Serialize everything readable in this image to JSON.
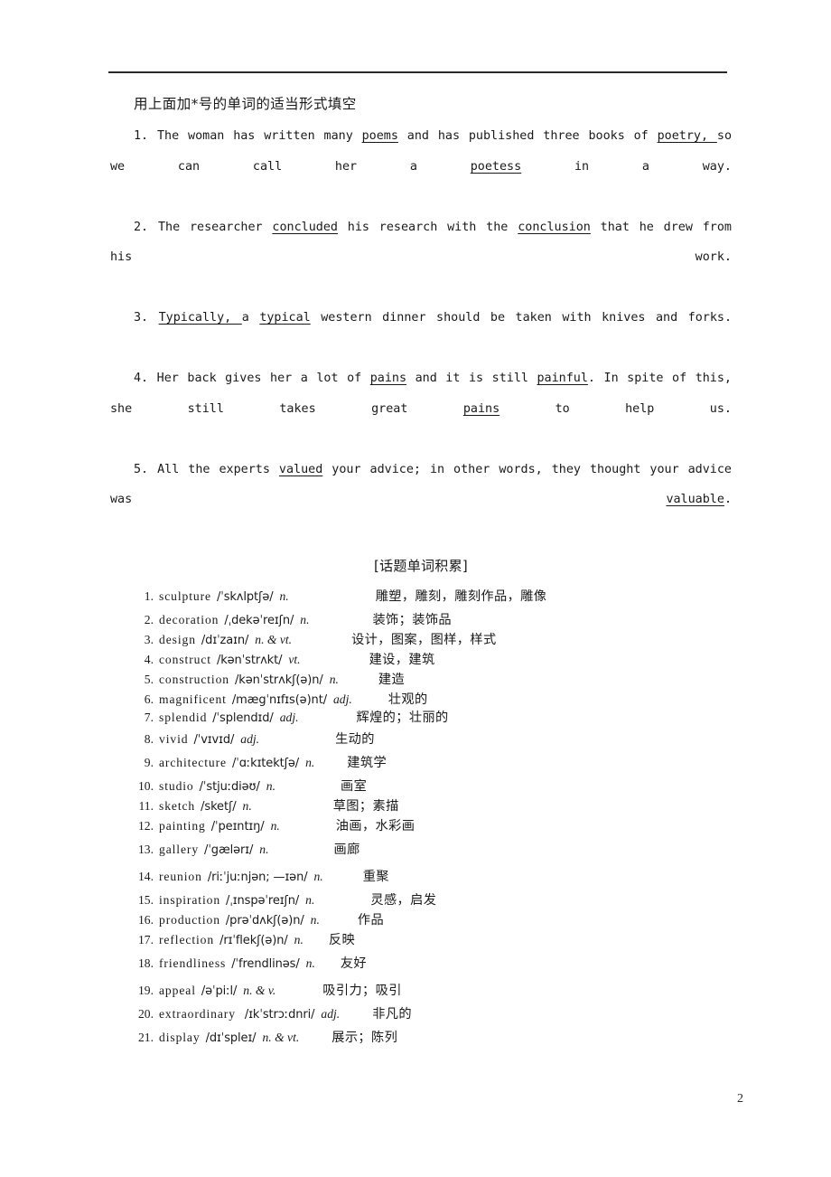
{
  "document": {
    "page_number": "2",
    "rule_color": "#2a2a2a"
  },
  "exercise": {
    "heading": "用上面加*号的单词的适当形式填空",
    "items": [
      {
        "number": "1.",
        "parts": [
          {
            "text": "The woman has written many ",
            "underline": false
          },
          {
            "text": "poems",
            "underline": true
          },
          {
            "text": " and has published three books of ",
            "underline": false
          },
          {
            "text": "poetry, ",
            "underline": true
          },
          {
            "text": "so we can call her a ",
            "underline": false
          },
          {
            "text": "poetess",
            "underline": true
          },
          {
            "text": " in a way.",
            "underline": false
          }
        ]
      },
      {
        "number": "2.",
        "parts": [
          {
            "text": "The researcher ",
            "underline": false
          },
          {
            "text": "concluded",
            "underline": true
          },
          {
            "text": " his research with the ",
            "underline": false
          },
          {
            "text": "conclusion",
            "underline": true
          },
          {
            "text": " that he drew from his work.",
            "underline": false
          }
        ]
      },
      {
        "number": "3.",
        "parts": [
          {
            "text": "",
            "underline": false
          },
          {
            "text": "Typically, ",
            "underline": true
          },
          {
            "text": "a ",
            "underline": false
          },
          {
            "text": "typical",
            "underline": true
          },
          {
            "text": " western dinner should be taken with knives and forks.",
            "underline": false
          }
        ]
      },
      {
        "number": "4.",
        "parts": [
          {
            "text": "Her back gives her a lot of ",
            "underline": false
          },
          {
            "text": "pains",
            "underline": true
          },
          {
            "text": " and it is still ",
            "underline": false
          },
          {
            "text": "painful",
            "underline": true
          },
          {
            "text": ". In spite of this, she still takes great ",
            "underline": false
          },
          {
            "text": "pains",
            "underline": true
          },
          {
            "text": " to help us.",
            "underline": false
          }
        ]
      },
      {
        "number": "5.",
        "parts": [
          {
            "text": "All the experts ",
            "underline": false
          },
          {
            "text": "valued",
            "underline": true
          },
          {
            "text": " your advice; in other words, they thought your advice was ",
            "underline": false
          },
          {
            "text": "valuable",
            "underline": true
          },
          {
            "text": ".",
            "underline": false
          }
        ]
      }
    ]
  },
  "vocabulary": {
    "title": "[话题单词积累]",
    "entries": [
      {
        "number": "1.",
        "word": "sculpture",
        "ipa": "/ˈskʌlptʃə/",
        "pos": "n.",
        "gloss": "雕塑，雕刻，雕刻作品，雕像",
        "gloss_gap": 96,
        "row_gap": 6
      },
      {
        "number": "2.",
        "word": "decoration",
        "ipa": "/ˌdekəˈreɪʃn/",
        "pos": "n.",
        "gloss": "装饰；装饰品",
        "gloss_gap": 70,
        "row_gap": 6
      },
      {
        "number": "3.",
        "word": "design",
        "ipa": "/dɪˈzaɪn/",
        "pos": "n. & vt.",
        "gloss": "设计，图案，图样，样式",
        "gloss_gap": 66,
        "row_gap": 2
      },
      {
        "number": "4.",
        "word": "construct",
        "ipa": "/kənˈstrʌkt/",
        "pos": "vt.",
        "gloss": "建设，建筑",
        "gloss_gap": 76,
        "row_gap": 2
      },
      {
        "number": "5.",
        "word": "construction",
        "ipa": "/kənˈstrʌkʃ(ə)n/",
        "pos": "n.",
        "gloss": "建造",
        "gloss_gap": 44,
        "row_gap": 2
      },
      {
        "number": "6.",
        "word": "magnificent",
        "ipa": "/mægˈnɪfɪs(ə)nt/",
        "pos": "adj.",
        "gloss": "壮观的",
        "gloss_gap": 40,
        "row_gap": 2
      },
      {
        "number": "7.",
        "word": "splendid",
        "ipa": "/ˈsplendɪd/",
        "pos": "adj.",
        "gloss": "辉煌的；壮丽的",
        "gloss_gap": 64,
        "row_gap": 0
      },
      {
        "number": "8.",
        "word": "vivid",
        "ipa": "/ˈvɪvɪd/",
        "pos": "adj.",
        "gloss": "生动的",
        "gloss_gap": 84,
        "row_gap": 4
      },
      {
        "number": "9.",
        "word": "architecture",
        "ipa": "/ˈɑːkɪtektʃə/",
        "pos": "n.",
        "gloss": "建筑学",
        "gloss_gap": 36,
        "row_gap": 6
      },
      {
        "number": "10.",
        "word": "studio",
        "ipa": "/ˈstjuːdiəʊ/",
        "pos": "n.",
        "gloss": "画室",
        "gloss_gap": 72,
        "row_gap": 6
      },
      {
        "number": "11.",
        "word": "sketch",
        "ipa": "/sketʃ/",
        "pos": "n.",
        "gloss": "草图；素描",
        "gloss_gap": 90,
        "row_gap": 2
      },
      {
        "number": "12.",
        "word": "painting",
        "ipa": "/ˈpeɪntɪŋ/",
        "pos": "n.",
        "gloss": "油画，水彩画",
        "gloss_gap": 62,
        "row_gap": 2
      },
      {
        "number": "13.",
        "word": "gallery",
        "ipa": "/ˈgælərɪ/",
        "pos": "n.",
        "gloss": "画廊",
        "gloss_gap": 72,
        "row_gap": 6
      },
      {
        "number": "14.",
        "word": "reunion",
        "ipa": "/riːˈjuːnjən; —ɪən/",
        "pos": "n.",
        "gloss": "重聚",
        "gloss_gap": 44,
        "row_gap": 10
      },
      {
        "number": "15.",
        "word": "inspiration",
        "ipa": "/ˌɪnspəˈreɪʃn/",
        "pos": "n.",
        "gloss": "灵感，启发",
        "gloss_gap": 62,
        "row_gap": 6
      },
      {
        "number": "16.",
        "word": "production",
        "ipa": "/prəˈdʌkʃ(ə)n/",
        "pos": "n.",
        "gloss": "作品",
        "gloss_gap": 42,
        "row_gap": 2
      },
      {
        "number": "17.",
        "word": "reflection",
        "ipa": "/rɪˈflekʃ(ə)n/",
        "pos": "n.",
        "gloss": "反映",
        "gloss_gap": 28,
        "row_gap": 2
      },
      {
        "number": "18.",
        "word": "friendliness",
        "ipa": "/ˈfrendlinəs/",
        "pos": "n.",
        "gloss": "友好",
        "gloss_gap": 28,
        "row_gap": 6
      },
      {
        "number": "19.",
        "word": "appeal",
        "ipa": "/əˈpiːl/",
        "pos": "n. & v.",
        "gloss": "吸引力；吸引",
        "gloss_gap": 52,
        "row_gap": 10
      },
      {
        "number": "20.",
        "word": "extraordinary",
        "ipa": "/ɪkˈstrɔːdnri/",
        "pos": "adj.",
        "gloss": "非凡的",
        "gloss_gap": 36,
        "row_gap": 6,
        "word_gap": 10
      },
      {
        "number": "21.",
        "word": "display",
        "ipa": "/dɪˈspleɪ/",
        "pos": "n. & vt.",
        "gloss": "展示；陈列",
        "gloss_gap": 36,
        "row_gap": 6
      }
    ]
  }
}
